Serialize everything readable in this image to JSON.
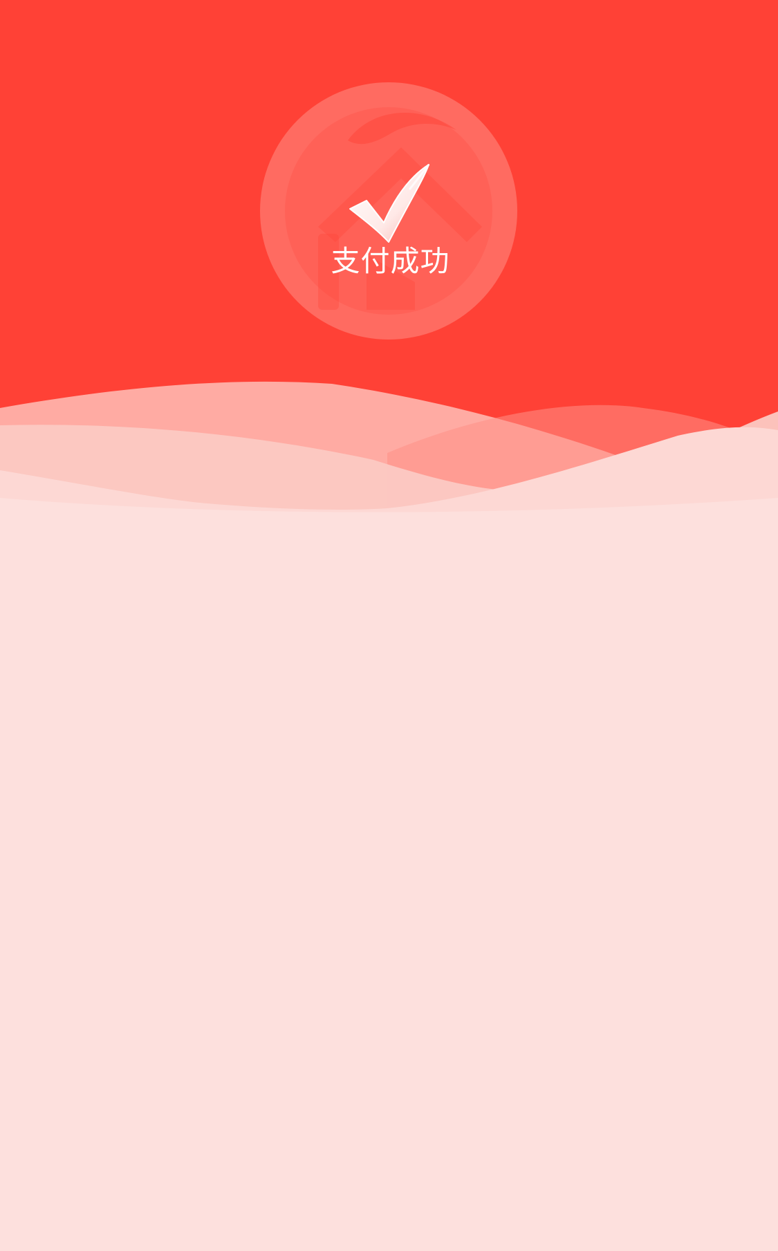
{
  "payment_result": {
    "status_text": "支付成功",
    "status_icon": "checkmark-icon",
    "logo_icon": "house-brand-logo-icon"
  },
  "colors": {
    "header_background": "#ff4136",
    "body_background": "#fde0dd",
    "logo_overlay": "#ff6b61",
    "status_text": "#ffffff"
  }
}
